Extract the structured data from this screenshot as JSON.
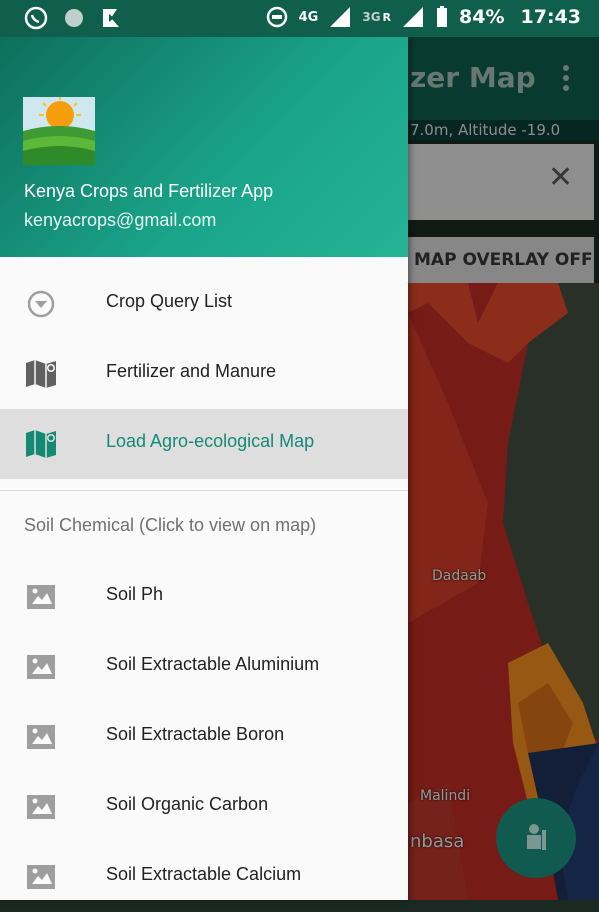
{
  "status_bar": {
    "battery": "84%",
    "time": "17:43",
    "network1": "4G",
    "network2": "3G",
    "roaming": "R",
    "icons": [
      "whatsapp-icon",
      "dot-icon",
      "media-icon",
      "sync-icon",
      "signal-icon",
      "battery-icon"
    ]
  },
  "app": {
    "title_fragment": "zer Map",
    "coords_fragment": "7.0m, Altitude -19.0",
    "map_overlay_button": "MAP OVERLAY OFF",
    "map_labels": [
      "Dadaab",
      "Malindi",
      "nbasa"
    ]
  },
  "drawer": {
    "header": {
      "app_name": "Kenya Crops and Fertilizer App",
      "email": "kenyacrops@gmail.com"
    },
    "items": [
      {
        "label": "Crop Query List",
        "icon": "dropdown-circle-icon"
      },
      {
        "label": "Fertilizer and Manure",
        "icon": "map-icon"
      },
      {
        "label": "Load Agro-ecological Map",
        "icon": "map-icon",
        "active": true
      }
    ],
    "section_title": "Soil Chemical (Click to view on map)",
    "soil_items": [
      {
        "label": "Soil Ph",
        "icon": "image-icon"
      },
      {
        "label": "Soil Extractable Aluminium",
        "icon": "image-icon"
      },
      {
        "label": "Soil Extractable Boron",
        "icon": "image-icon"
      },
      {
        "label": "Soil Organic Carbon",
        "icon": "image-icon"
      },
      {
        "label": "Soil Extractable Calcium",
        "icon": "image-icon"
      }
    ]
  },
  "colors": {
    "primary": "#0d5a4b",
    "accent": "#148a75",
    "header_gradient_end": "#24b394"
  }
}
